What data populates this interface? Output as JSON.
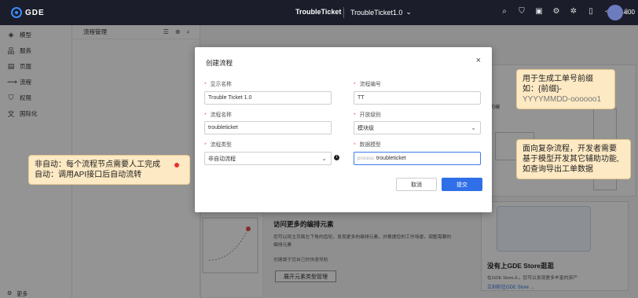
{
  "topbar": {
    "logo_text": "GDE",
    "app_title": "TroubleTicket",
    "project_title": "TroubleTicket1.0",
    "project_chevron": "⌄",
    "icons": [
      "search-icon",
      "shield-icon",
      "clipboard-icon",
      "settings-icon",
      "gear-icon",
      "mobile-icon",
      "megaphone-icon",
      "bell-icon"
    ],
    "user": "c00"
  },
  "leftnav": {
    "items": [
      {
        "label": "模型",
        "icon": "cube-icon"
      },
      {
        "label": "服务",
        "icon": "network-icon"
      },
      {
        "label": "页面",
        "icon": "page-icon"
      },
      {
        "label": "流程",
        "icon": "flow-icon"
      },
      {
        "label": "权限",
        "icon": "shield-icon"
      },
      {
        "label": "国际化",
        "icon": "translate-icon"
      }
    ],
    "bottom_label": "更多"
  },
  "subpane": {
    "title": "流程管理"
  },
  "main": {
    "more_title": "访问更多的编排元素",
    "more_desc": "您可以将主页面左下角的齿轮，发现更多的编排元素，并根据您的工作场景，调整需要的编排元素",
    "more_link": "创建属于您自己的快速导航",
    "open_button": "展开元素类型管理",
    "store_title": "没有上GDE Store逛逛",
    "store_desc": "在GDE Store上，您可以发现更多丰富的资产",
    "store_link": "立刻前往GDE Store →"
  },
  "dialog": {
    "title": "创建流程",
    "close": "×",
    "fields": {
      "display_name_label": "显示名称",
      "display_name_value": "Trouble Ticket 1.0",
      "process_code_label": "流程编号",
      "process_code_value": "TT",
      "process_name_label": "流程名称",
      "process_name_value": "troubleticket",
      "open_level_label": "开放级别",
      "open_level_value": "模块级",
      "process_type_label": "流程类型",
      "process_type_value": "非自动流程",
      "data_model_label": "数据模型",
      "data_model_prefix": "process",
      "data_model_value": "troubleticket"
    },
    "cancel_label": "取消",
    "submit_label": "提交"
  },
  "callouts": {
    "left_line1": "非自动：每个流程节点需要人工完成",
    "left_line2": "自动：调用API接口后自动流转",
    "top_right_line1": "用于生成工单号前缀",
    "top_right_line2": "如：{前缀}-",
    "top_right_line3": "YYYYMMDD-oooooo1",
    "mid_right_line1": "面向复杂流程，开发者需要",
    "mid_right_line2": "基于模型开发其它辅助功能,",
    "mid_right_line3": "如查询导出工单数据"
  }
}
